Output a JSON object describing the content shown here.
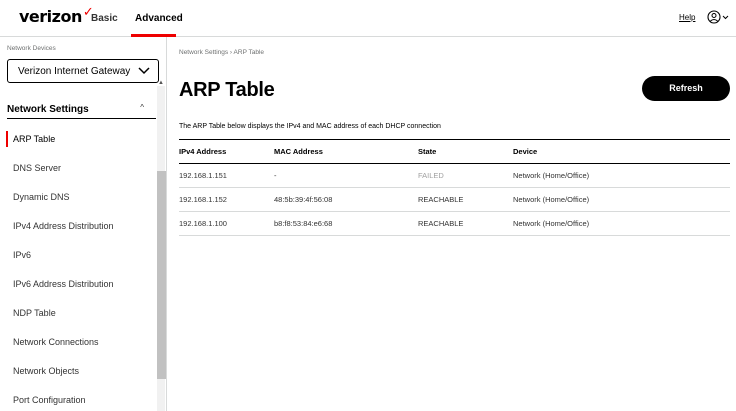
{
  "header": {
    "brand": "verizon",
    "brand_mark": "✓",
    "tabs": [
      {
        "label": "Basic"
      },
      {
        "label": "Advanced"
      }
    ],
    "help_label": "Help",
    "user_icon": "user-circle-icon"
  },
  "sidebar": {
    "device_label": "Network Devices",
    "device_selected": "Verizon Internet Gateway",
    "section_title": "Network Settings",
    "section_caret": "^",
    "items": [
      {
        "label": "ARP Table"
      },
      {
        "label": "DNS Server"
      },
      {
        "label": "Dynamic DNS"
      },
      {
        "label": "IPv4 Address Distribution"
      },
      {
        "label": "IPv6"
      },
      {
        "label": "IPv6 Address Distribution"
      },
      {
        "label": "NDP Table"
      },
      {
        "label": "Network Connections"
      },
      {
        "label": "Network Objects"
      },
      {
        "label": "Port Configuration"
      }
    ]
  },
  "main": {
    "breadcrumb": "Network Settings  ›  ARP Table",
    "title": "ARP Table",
    "refresh_label": "Refresh",
    "description": "The ARP Table below displays the IPv4 and MAC address of each DHCP connection",
    "table": {
      "headers": [
        "IPv4 Address",
        "MAC Address",
        "State",
        "Device"
      ],
      "rows": [
        [
          "192.168.1.151",
          "-",
          "FAILED",
          "Network (Home/Office)"
        ],
        [
          "192.168.1.152",
          "48:5b:39:4f:56:08",
          "REACHABLE",
          "Network (Home/Office)"
        ],
        [
          "192.168.1.100",
          "b8:f8:53:84:e6:68",
          "REACHABLE",
          "Network (Home/Office)"
        ]
      ]
    }
  },
  "colors": {
    "accent": "#ee0000",
    "button": "#000000",
    "failed_text": "#a0a0a0"
  }
}
